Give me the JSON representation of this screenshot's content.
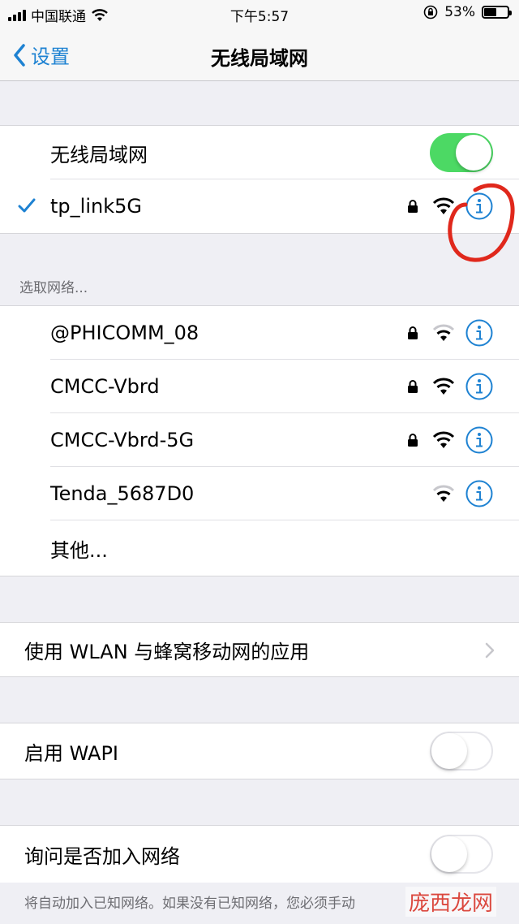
{
  "status_bar": {
    "carrier": "中国联通",
    "time": "下午5:57",
    "battery_percent": "53%",
    "battery_level": 0.53
  },
  "nav": {
    "back_label": "设置",
    "title": "无线局域网"
  },
  "wifi_toggle": {
    "label": "无线局域网",
    "on": true
  },
  "connected": {
    "name": "tp_link5G",
    "secured": true
  },
  "choose_network": {
    "header": "选取网络...",
    "networks": [
      {
        "name": "@PHICOMM_08",
        "secured": true
      },
      {
        "name": "CMCC-Vbrd",
        "secured": true
      },
      {
        "name": "CMCC-Vbrd-5G",
        "secured": true
      },
      {
        "name": "Tenda_5687D0",
        "secured": false
      }
    ],
    "other_label": "其他..."
  },
  "apps_row": {
    "label": "使用 WLAN 与蜂窝移动网的应用"
  },
  "wapi": {
    "label": "启用 WAPI",
    "on": false
  },
  "ask_join": {
    "label": "询问是否加入网络",
    "on": false
  },
  "footer": {
    "note": "将自动加入已知网络。如果没有已知网络，您必须手动"
  },
  "watermark": {
    "text": "庞西龙网"
  },
  "colors": {
    "accent": "#1e82d2",
    "toggle_on": "#4cd964",
    "annotation": "#e0281c"
  }
}
